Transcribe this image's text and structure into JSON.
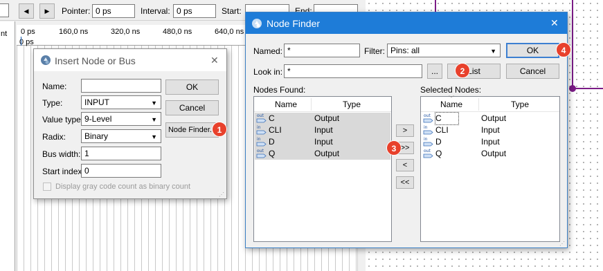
{
  "toolbar": {
    "prev_label": "◀",
    "next_label": "▶",
    "pointer_label": "Pointer:",
    "pointer_value": "0 ps",
    "interval_label": "Interval:",
    "interval_value": "0 ps",
    "start_label": "Start:",
    "end_label": "End:"
  },
  "left_edge_text": "nt",
  "timeline": {
    "ticks": [
      "0 ps",
      "160,0 ns",
      "320,0 ns",
      "480,0 ns",
      "640,0 ns"
    ],
    "row_label": "0 ps"
  },
  "insert_dialog": {
    "title": "Insert Node or Bus",
    "close": "✕",
    "name_label": "Name:",
    "name_value": "",
    "type_label": "Type:",
    "type_value": "INPUT",
    "value_type_label": "Value type",
    "value_type_value": "9-Level",
    "radix_label": "Radix:",
    "radix_value": "Binary",
    "bus_width_label": "Bus width:",
    "bus_width_value": "1",
    "start_index_label": "Start index",
    "start_index_value": "0",
    "gray_code_label": "Display gray code count as binary count",
    "ok_label": "OK",
    "cancel_label": "Cancel",
    "node_finder_label": "Node Finder..."
  },
  "node_finder": {
    "title": "Node Finder",
    "close": "✕",
    "named_label": "Named:",
    "named_value": "*",
    "filter_label": "Filter:",
    "filter_value": "Pins: all",
    "look_in_label": "Look in:",
    "look_in_value": "*",
    "browse_label": "...",
    "list_label": "List",
    "ok_label": "OK",
    "cancel_label": "Cancel",
    "nodes_found_label": "Nodes Found:",
    "selected_nodes_label": "Selected Nodes:",
    "col_name": "Name",
    "col_type": "Type",
    "nodes_found": [
      {
        "icon": "output-pin-icon",
        "name": "C",
        "type": "Output"
      },
      {
        "icon": "input-pin-icon",
        "name": "CLI",
        "type": "Input"
      },
      {
        "icon": "input-pin-icon",
        "name": "D",
        "type": "Input"
      },
      {
        "icon": "output-pin-icon",
        "name": "Q",
        "type": "Output"
      }
    ],
    "selected_nodes": [
      {
        "icon": "output-pin-icon",
        "name": "C",
        "type": "Output"
      },
      {
        "icon": "input-pin-icon",
        "name": "CLI",
        "type": "Input"
      },
      {
        "icon": "input-pin-icon",
        "name": "D",
        "type": "Input"
      },
      {
        "icon": "output-pin-icon",
        "name": "Q",
        "type": "Output"
      }
    ],
    "move_one_right": ">",
    "move_all_right": ">>",
    "move_one_left": "<",
    "move_all_left": "<<"
  },
  "badges": [
    "1",
    "2",
    "3",
    "4"
  ],
  "colors": {
    "badge": "#e8412c",
    "selection": "#d9d9d9",
    "accent_border": "#3c7fd1",
    "schematic_wire": "#7b1c86"
  }
}
